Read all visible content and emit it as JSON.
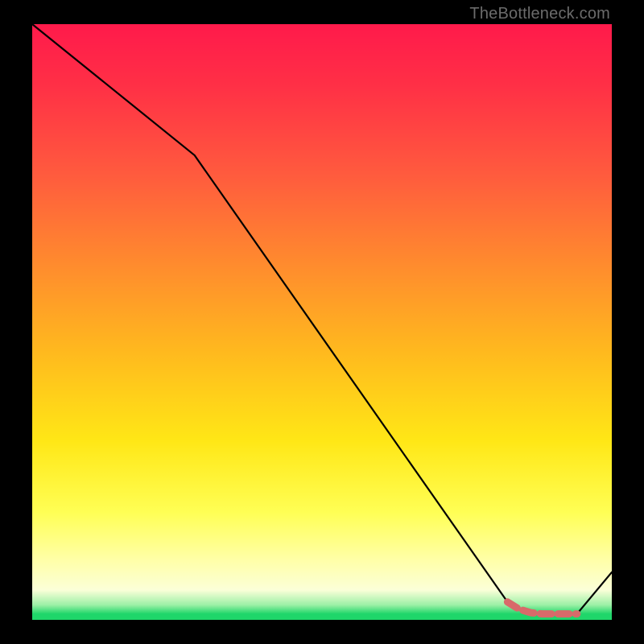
{
  "watermark": "TheBottleneck.com",
  "chart_data": {
    "type": "line",
    "title": "",
    "xlabel": "",
    "ylabel": "",
    "xlim": [
      0,
      100
    ],
    "ylim": [
      0,
      100
    ],
    "series": [
      {
        "name": "main-line",
        "color": "#000000",
        "x": [
          0,
          28,
          82,
          86,
          94,
          100
        ],
        "y": [
          100,
          78,
          3,
          1,
          1,
          8
        ]
      },
      {
        "name": "highlight-band",
        "color": "#d86a6a",
        "x": [
          82,
          84,
          86,
          88,
          90,
          92,
          94
        ],
        "y": [
          3,
          1.8,
          1.2,
          1.0,
          1.0,
          1.0,
          1.0
        ]
      }
    ],
    "background_gradient": {
      "stops": [
        {
          "pos": 0.0,
          "color": "#ff1a4b"
        },
        {
          "pos": 0.4,
          "color": "#ff8a2e"
        },
        {
          "pos": 0.7,
          "color": "#ffe716"
        },
        {
          "pos": 0.9,
          "color": "#ffffa8"
        },
        {
          "pos": 0.99,
          "color": "#1fd66a"
        }
      ]
    }
  }
}
